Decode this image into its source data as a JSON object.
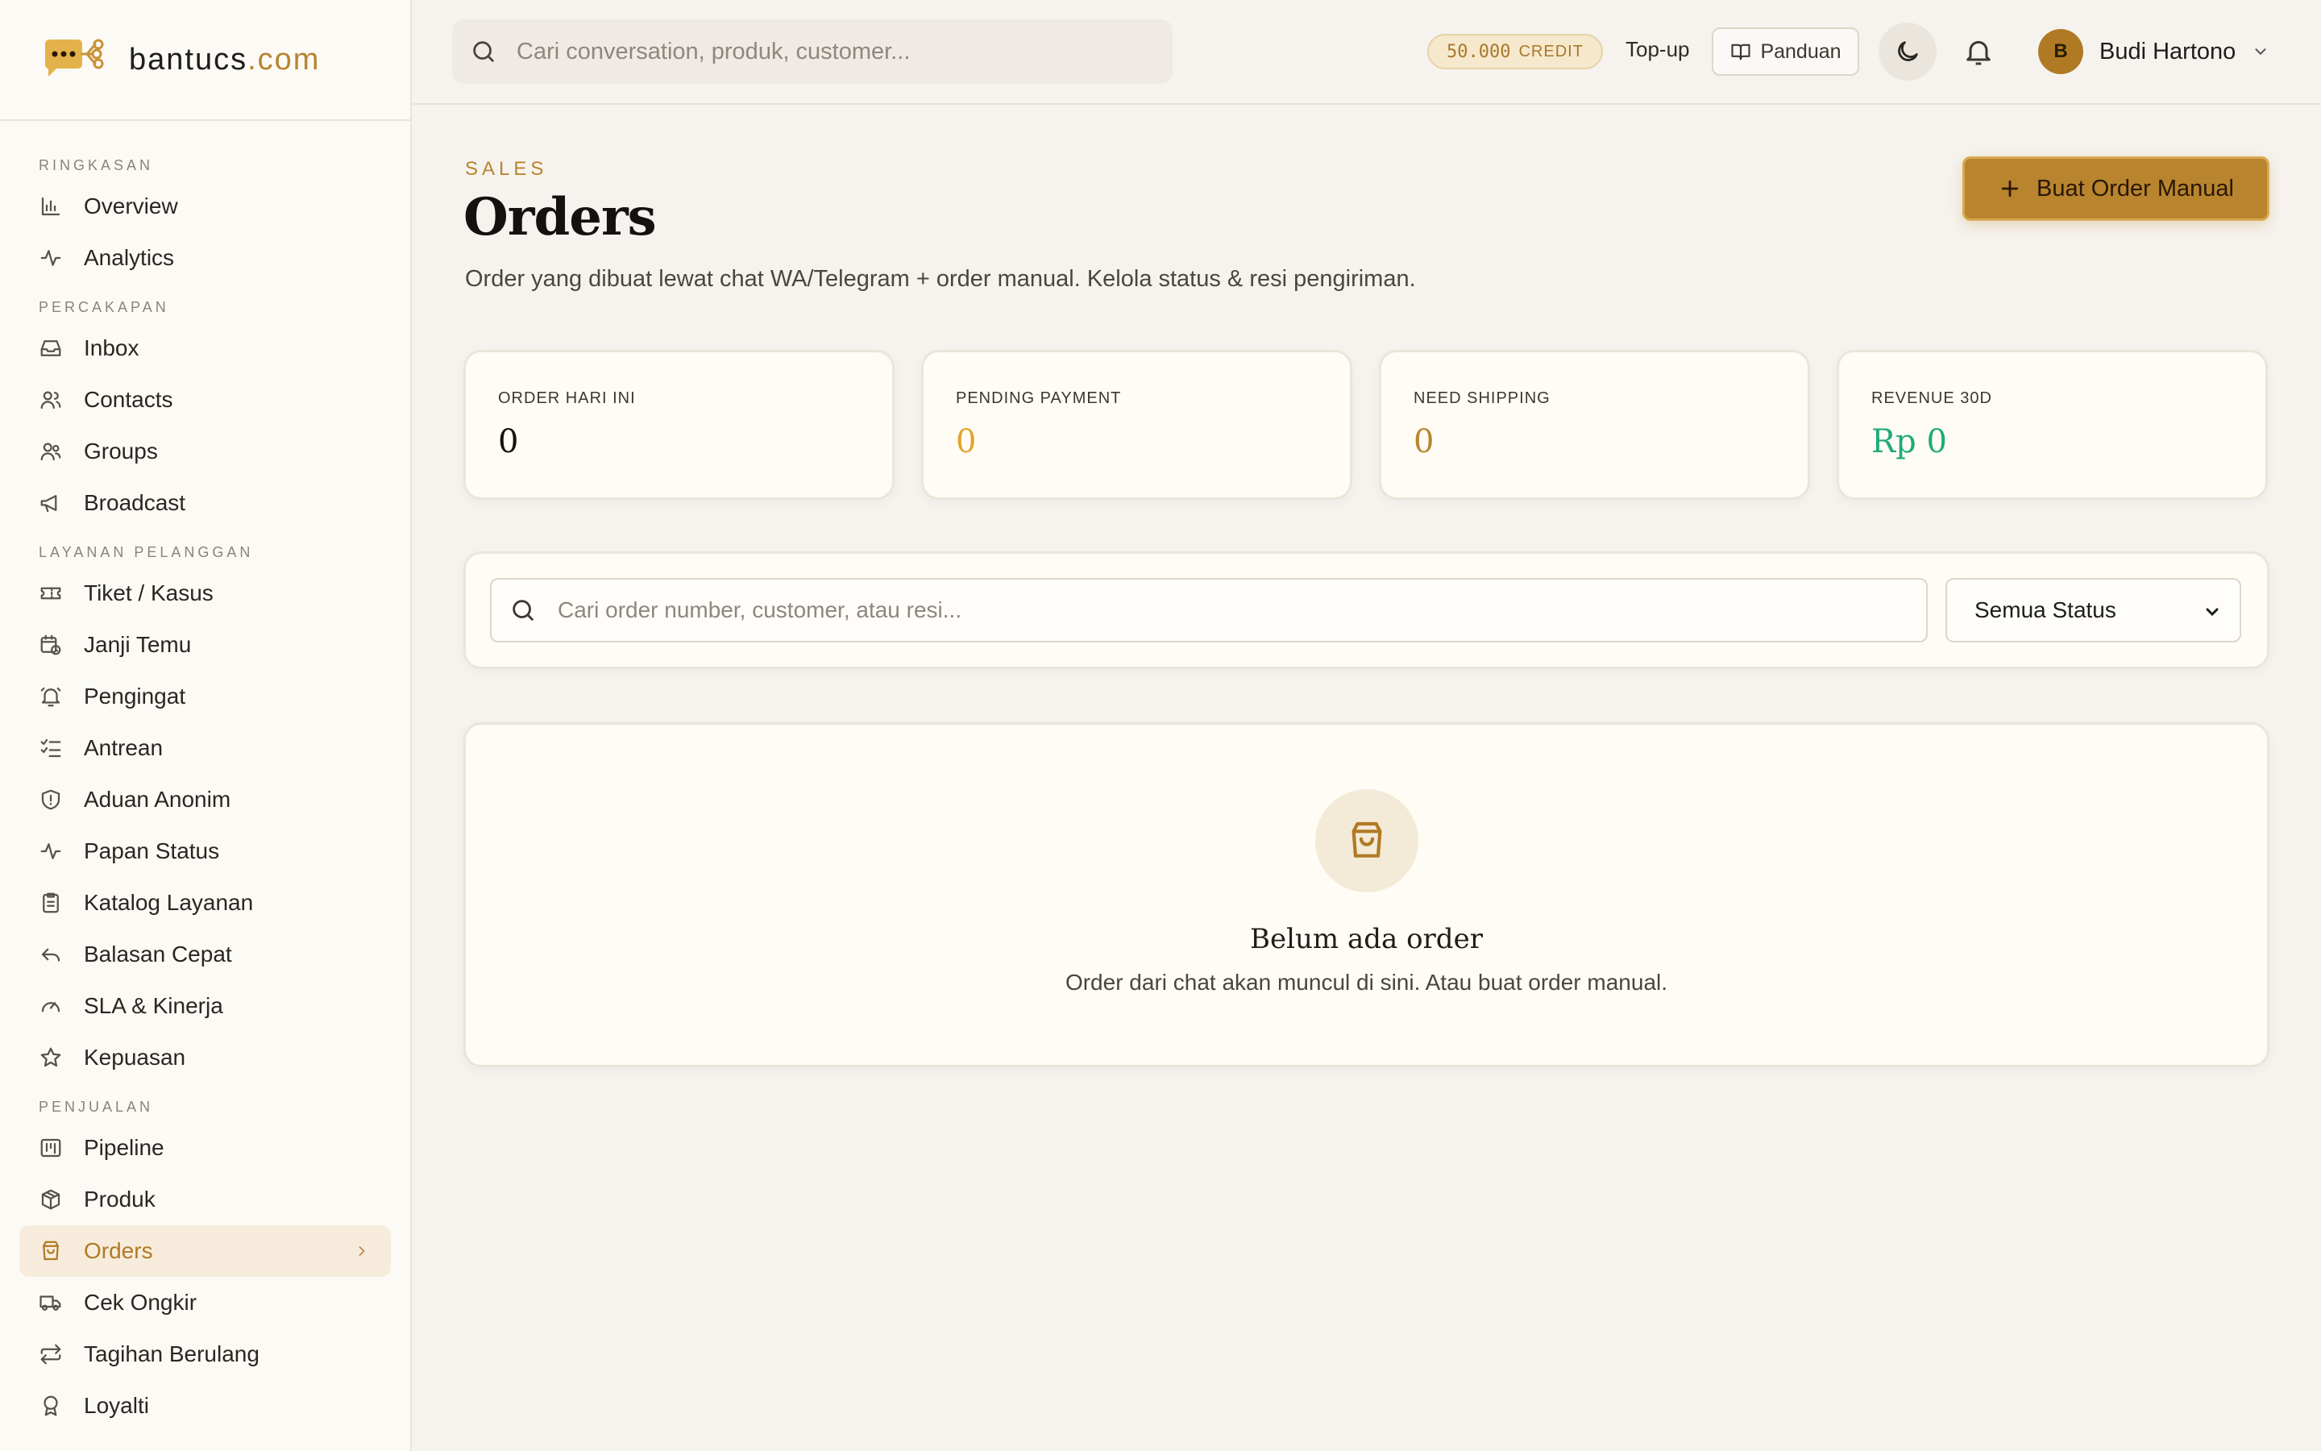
{
  "brand": {
    "name": "bantucs",
    "tld": ".com"
  },
  "colors": {
    "accent": "#b8842e",
    "pending": "#e0a52b",
    "revenue": "#1faa7c",
    "sidebar_active_bg": "#f7ecdc"
  },
  "sidebar": {
    "sections": [
      {
        "title": "RINGKASAN",
        "items": [
          {
            "label": "Overview",
            "icon": "bar-chart-icon"
          },
          {
            "label": "Analytics",
            "icon": "activity-icon"
          }
        ]
      },
      {
        "title": "PERCAKAPAN",
        "items": [
          {
            "label": "Inbox",
            "icon": "inbox-icon"
          },
          {
            "label": "Contacts",
            "icon": "users-icon"
          },
          {
            "label": "Groups",
            "icon": "user-group-icon"
          },
          {
            "label": "Broadcast",
            "icon": "megaphone-icon"
          }
        ]
      },
      {
        "title": "LAYANAN PELANGGAN",
        "items": [
          {
            "label": "Tiket / Kasus",
            "icon": "ticket-icon"
          },
          {
            "label": "Janji Temu",
            "icon": "calendar-clock-icon"
          },
          {
            "label": "Pengingat",
            "icon": "bell-ring-icon"
          },
          {
            "label": "Antrean",
            "icon": "list-checks-icon"
          },
          {
            "label": "Aduan Anonim",
            "icon": "shield-alert-icon"
          },
          {
            "label": "Papan Status",
            "icon": "pulse-icon"
          },
          {
            "label": "Katalog Layanan",
            "icon": "clipboard-list-icon"
          },
          {
            "label": "Balasan Cepat",
            "icon": "reply-icon"
          },
          {
            "label": "SLA & Kinerja",
            "icon": "gauge-icon"
          },
          {
            "label": "Kepuasan",
            "icon": "star-icon"
          }
        ]
      },
      {
        "title": "PENJUALAN",
        "items": [
          {
            "label": "Pipeline",
            "icon": "kanban-icon"
          },
          {
            "label": "Produk",
            "icon": "package-icon"
          },
          {
            "label": "Orders",
            "icon": "shopping-bag-icon",
            "active": true
          },
          {
            "label": "Cek Ongkir",
            "icon": "truck-icon"
          },
          {
            "label": "Tagihan Berulang",
            "icon": "repeat-icon"
          },
          {
            "label": "Loyalti",
            "icon": "award-icon"
          }
        ]
      }
    ]
  },
  "topbar": {
    "search_placeholder": "Cari conversation, produk, customer...",
    "credit_amount": "50.000",
    "credit_label": "CREDIT",
    "topup_label": "Top-up",
    "guide_label": "Panduan",
    "user_initial": "B",
    "user_name": "Budi Hartono"
  },
  "page": {
    "eyebrow": "SALES",
    "title": "Orders",
    "description": "Order yang dibuat lewat chat WA/Telegram + order manual. Kelola status & resi pengiriman.",
    "primary_button": "Buat Order Manual"
  },
  "stats": [
    {
      "label": "ORDER HARI INI",
      "value": "0",
      "color": "#141210"
    },
    {
      "label": "PENDING PAYMENT",
      "value": "0",
      "color": "#e0a52b"
    },
    {
      "label": "NEED SHIPPING",
      "value": "0",
      "color": "#b8842e"
    },
    {
      "label": "REVENUE 30D",
      "value": "Rp 0",
      "color": "#1faa7c"
    }
  ],
  "filters": {
    "search_placeholder": "Cari order number, customer, atau resi...",
    "status_selected": "Semua Status"
  },
  "empty_state": {
    "title": "Belum ada order",
    "description": "Order dari chat akan muncul di sini. Atau buat order manual."
  }
}
